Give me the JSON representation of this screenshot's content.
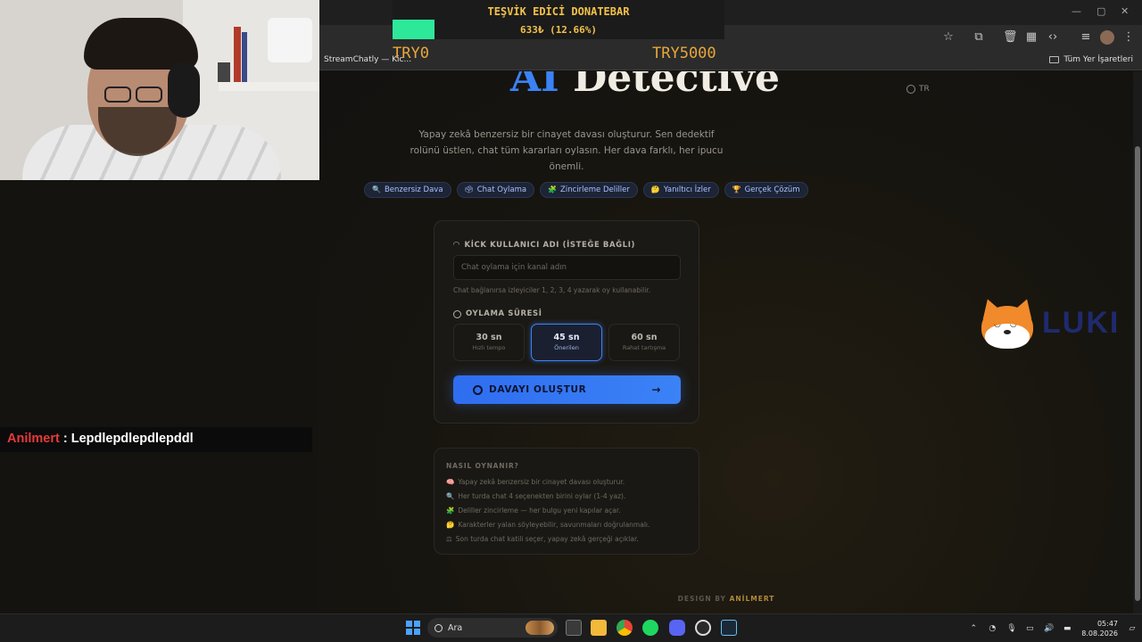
{
  "browser": {
    "tab_title": "StreamChatly — Kic...",
    "bookmarks_all": "Tüm Yer İşaretleri"
  },
  "donate_bar": {
    "title": "TEŞVİK EDİCİ DONATEBAR",
    "amount": "633₺ (12.66%)",
    "progress": 0.1266,
    "min_label": "TRY0",
    "max_label": "TRY5000",
    "fill_color": "#2ee89a",
    "text_color": "#f2c14a"
  },
  "page": {
    "lang": "TR",
    "title_ai": "AI",
    "title_rest": "Detective",
    "subtitle": "Yapay zekâ benzersiz bir cinayet davası oluşturur. Sen dedektif rolünü üstlen, chat tüm kararları oylasın. Her dava farklı, her ipucu önemli.",
    "chips": [
      {
        "icon": "🔍",
        "label": "Benzersiz Dava"
      },
      {
        "icon": "🗳",
        "label": "Chat Oylama"
      },
      {
        "icon": "🧩",
        "label": "Zincirleme Deliller"
      },
      {
        "icon": "🤔",
        "label": "Yanıltıcı İzler"
      },
      {
        "icon": "🏆",
        "label": "Gerçek Çözüm"
      }
    ],
    "kick_label": "KİCK KULLANICI ADI (İSTEĞE BAĞLI)",
    "kick_placeholder": "Chat oylama için kanal adın",
    "kick_hint": "Chat bağlanırsa izleyiciler 1, 2, 3, 4 yazarak oy kullanabilir.",
    "vote_label": "OYLAMA SÜRESİ",
    "options": [
      {
        "value": "30 sn",
        "sub": "Hızlı tempo",
        "selected": false
      },
      {
        "value": "45 sn",
        "sub": "Önerilen",
        "selected": true
      },
      {
        "value": "60 sn",
        "sub": "Rahat tartışma",
        "selected": false
      }
    ],
    "create_button": "DAVAYI OLUŞTUR",
    "how_title": "NASIL OYNANIR?",
    "how_items": [
      {
        "icon": "🧠",
        "text": "Yapay zekâ benzersiz bir cinayet davası oluşturur."
      },
      {
        "icon": "🔍",
        "text": "Her turda chat 4 seçenekten birini oylar (1-4 yaz)."
      },
      {
        "icon": "🧩",
        "text": "Deliller zincirleme — her bulgu yeni kapılar açar."
      },
      {
        "icon": "🤔",
        "text": "Karakterler yalan söyleyebilir, savunmaları doğrulanmalı."
      },
      {
        "icon": "⚖",
        "text": "Son turda chat katili seçer, yapay zekâ gerçeği açıklar."
      }
    ],
    "credit_prefix": "DESIGN BY",
    "credit_name": "ANİLMERT",
    "accent": "#3b82f6"
  },
  "chat_overlay": {
    "user": "Anilmert",
    "separator": " : ",
    "message": "Lepdlepdlepdlepddl"
  },
  "logo": {
    "text": "LUKI"
  },
  "taskbar": {
    "search": "Ara",
    "time": "05:47",
    "date": "8.08.2026"
  }
}
